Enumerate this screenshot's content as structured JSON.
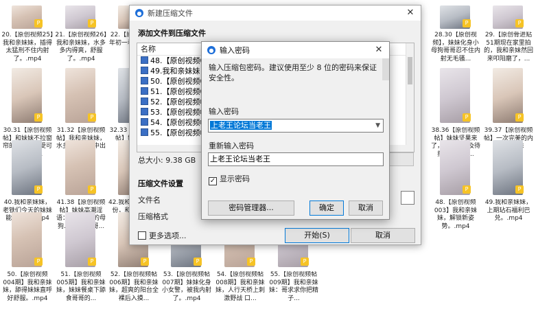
{
  "background_files": [
    {
      "caption": "20.【原创视频25】我和亲妹妹，插得太猛刑不住内射了。.mp4",
      "style": "t1",
      "full": false
    },
    {
      "caption": "21.【原创视频26】我和亲妹妹，水多多内得爽，舒服了。.mp4",
      "style": "t2",
      "full": false
    },
    {
      "caption": "22.【原创视频大年初一和亲妹妹在家",
      "style": "t3",
      "full": false
    },
    {
      "caption": "28.30【原创视频】，妹妹化身小母狗哥哥忍不住内射无毛骚...",
      "style": "t4",
      "full": false
    },
    {
      "caption": "29.【原创骨进贴51期现在家里拍的，我和亲妹然回来叩阳磨了，...",
      "style": "t2",
      "full": false
    },
    {
      "caption": "30.31【原创视频帖】和妹妹不拉窗帘的性爱，享受可能被看到...",
      "style": "t3",
      "full": true
    },
    {
      "caption": "31.32【原创视频帖】我和亲妹妹，水多多，内射中出我可要...",
      "style": "t1",
      "full": true
    },
    {
      "caption": "32.33【原创视频帖】妹妹前后",
      "style": "t4",
      "full": true
    },
    {
      "caption": "38.36【原创视频帖】妹妹坚果来了，小穴追不及待摆被插入，...",
      "style": "t2",
      "full": true
    },
    {
      "caption": "39.37【原创视频帖】一次完美的内射中出亲妹妹。.mp4",
      "style": "t3",
      "full": true
    },
    {
      "caption": "40.我和亲妹妹，老铁们今天的妹妹能打几分?.mp4",
      "style": "t4",
      "full": true
    },
    {
      "caption": "41.38【原创视频帖】妹妹高潮淫语：我是哥哥的母狗.......(原创哥...",
      "style": "t1",
      "full": true
    },
    {
      "caption": "42.我和亲妹妹9月份，和亲妹阳台",
      "style": "t3",
      "full": true
    },
    {
      "caption": "48.【原创视频003】我和亲妹妹，解锁新姿势。.mp4",
      "style": "t2",
      "full": true
    },
    {
      "caption": "49.我和亲妹妹，上期玷石福利巴兑。.mp4",
      "style": "t4",
      "full": true
    },
    {
      "caption": "50.【原创视频004期】我和亲妹妹，舔得妹妹直呼好舒服。.mp4",
      "style": "t1",
      "full": true
    },
    {
      "caption": "51.【原创视频005期】我和亲妹妹，妹妹餐桌下舔食哥哥的...",
      "style": "t2",
      "full": true
    },
    {
      "caption": "52.【原创视频帖006期】我和亲妹妹，超爽的阳台全裸后入摸...",
      "style": "t3",
      "full": true
    },
    {
      "caption": "53.【原创视频帖007期】妹妹化身小女警，被我内射了。.mp4",
      "style": "t4",
      "full": true
    },
    {
      "caption": "54.【原创视频帖008期】我和亲妹妹，人行天桥上刺激野战 口...",
      "style": "t1",
      "full": true
    },
    {
      "caption": "55.【原创视频帖009期】我和亲妹妹：哥求求你把精子...",
      "style": "t2",
      "full": true
    }
  ],
  "badge_text": "P",
  "main_dialog": {
    "title": "新建压缩文件",
    "close": "✕",
    "section_add": "添加文件到压缩文件",
    "column_name": "名称",
    "files": [
      "48.【原创视频003】",
      "49.我和亲妹妹，上期",
      "50.【原创视频004期】",
      "51.【原创视频005期】",
      "52.【原创视频帖006",
      "53.【原创视频帖007",
      "54.【原创视频帖008期】",
      "55.【原创视频帖009"
    ],
    "total_size": "总大小: 9.38 GB",
    "section_settings": "压缩文件设置",
    "label_filename": "文件名",
    "label_format": "压缩格式",
    "more_options": "更多选项...",
    "btn_start": "开始(S)",
    "btn_cancel": "取消"
  },
  "password_dialog": {
    "title": "输入密码",
    "close": "✕",
    "description": "输入压缩包密码。建议使用至少 8 位的密码来保证安全性。",
    "label_password": "输入密码",
    "password_value": "上老王论坛当老王",
    "label_confirm": "重新输入密码",
    "confirm_value": "上老王论坛当老王",
    "show_password_label": "显示密码",
    "show_password_checked": true,
    "btn_manager": "密码管理器...",
    "btn_ok": "确定",
    "btn_cancel": "取消"
  },
  "colors": {
    "accent": "#0078d7",
    "badge": "#f6c325"
  }
}
